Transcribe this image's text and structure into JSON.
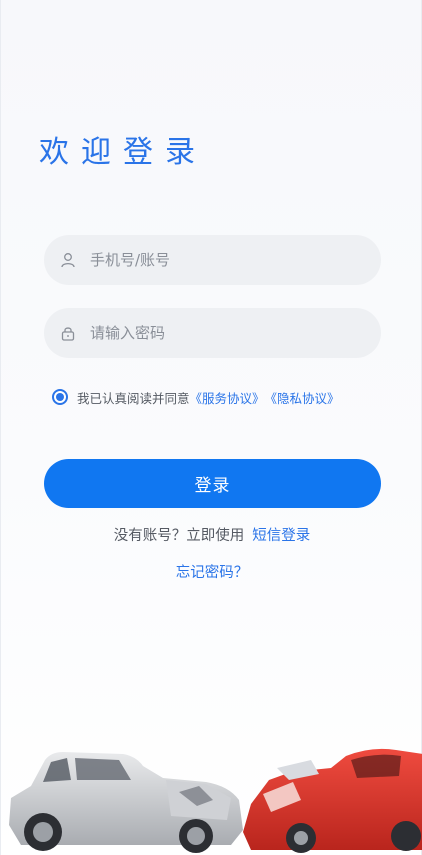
{
  "title": "欢迎登录",
  "phone_field": {
    "placeholder": "手机号/账号",
    "icon": "user-icon"
  },
  "password_field": {
    "placeholder": "请输入密码",
    "icon": "lock-icon"
  },
  "agreement": {
    "prefix": "我已认真阅读并同意",
    "service_link": "《服务协议》",
    "privacy_link": "《隐私协议》",
    "checked": true
  },
  "login_button": "登录",
  "signup": {
    "prompt": "没有账号？立即使用",
    "sms_link": "短信登录"
  },
  "forgot_password": "忘记密码？",
  "colors": {
    "accent": "#2a74e8",
    "button": "#1077f1",
    "field_bg": "#eef0f3"
  }
}
